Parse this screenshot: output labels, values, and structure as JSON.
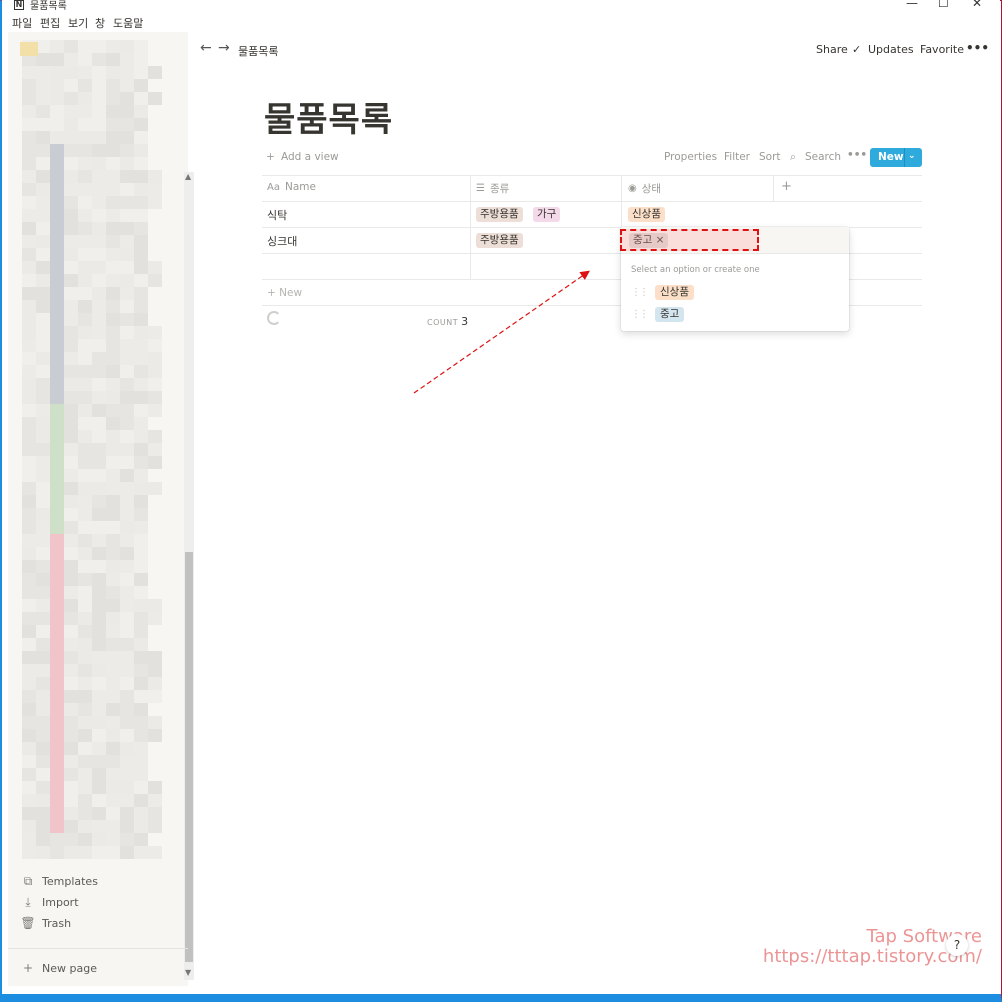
{
  "window": {
    "title": "물품목록",
    "app_icon": "N",
    "minimize": "—",
    "maximize": "☐",
    "close": "✕"
  },
  "menu": [
    "파일",
    "편집",
    "보기",
    "창",
    "도움말"
  ],
  "sidebar": {
    "bottom_items": [
      {
        "label": "Templates",
        "icon": "templates-icon"
      },
      {
        "label": "Import",
        "icon": "import-icon"
      },
      {
        "label": "Trash",
        "icon": "trash-icon"
      }
    ],
    "new_page": "New page"
  },
  "topbar": {
    "breadcrumb": "물품목록",
    "share": "Share",
    "updates": "Updates",
    "favorite": "Favorite",
    "more": "•••"
  },
  "page": {
    "title": "물품목록"
  },
  "viewbar": {
    "add_view": "Add a view",
    "properties": "Properties",
    "filter": "Filter",
    "sort": "Sort",
    "search": "Search",
    "more": "•••",
    "new": "New"
  },
  "table": {
    "columns": [
      {
        "label": "Name",
        "icon": "Aa"
      },
      {
        "label": "종류",
        "icon": "☰"
      },
      {
        "label": "상태",
        "icon": "◉"
      }
    ],
    "add_column": "+",
    "rows": [
      {
        "name": "식탁",
        "kind": [
          "주방용품",
          "가구"
        ],
        "status": "신상품"
      },
      {
        "name": "싱크대",
        "kind": [
          "주방용품"
        ],
        "status": "중고"
      },
      {
        "name": "",
        "kind": [],
        "status": ""
      }
    ],
    "new_row": "New",
    "count_label": "COUNT",
    "count_value": "3"
  },
  "popup": {
    "selected": "중고",
    "remove": "×",
    "hint": "Select an option or create one",
    "options": [
      "신상품",
      "중고"
    ]
  },
  "watermark": {
    "line1": "Tap Software",
    "line2": "https://tttap.tistory.com/"
  },
  "help": "?",
  "colors": {
    "accent": "#2eaadc",
    "annotation": "#dd1111"
  }
}
